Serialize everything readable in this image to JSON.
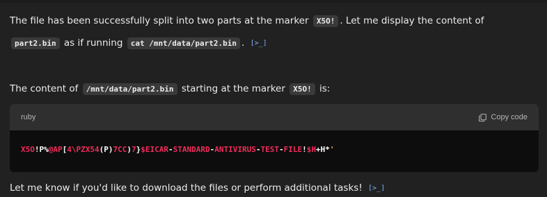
{
  "colors": {
    "background": "#212121",
    "inline_code_bg": "#3a3a3a",
    "code_block_bg": "#0d0d0d",
    "code_header_bg": "#2f2f2f",
    "link_blue": "#7ab7ff",
    "token_red": "#f22c5b",
    "token_white": "#ffffff",
    "token_gold": "#e6b450"
  },
  "message": {
    "line1": {
      "text_a": "The file has been successfully split into two parts at the marker",
      "code_a": "X5O!",
      "text_b": ". Let me display the content of"
    },
    "line2": {
      "code_a": "part2.bin",
      "text_a": "as if running",
      "code_b": "cat /mnt/data/part2.bin",
      "text_b": ".",
      "badge": "[>_]"
    },
    "line3": {
      "text_a": "The content of",
      "code_a": "/mnt/data/part2.bin",
      "text_b": "starting at the marker",
      "code_b": "X5O!",
      "text_c": "is:"
    },
    "code_block": {
      "language": "ruby",
      "copy_label": "Copy code",
      "copy_icon": "copy-icon",
      "tokens": [
        {
          "text": "X5O",
          "color": "#f22c5b"
        },
        {
          "text": "!P%",
          "color": "#ffffff"
        },
        {
          "text": "@AP",
          "color": "#f22c5b"
        },
        {
          "text": "[",
          "color": "#ffffff"
        },
        {
          "text": "4",
          "color": "#f22c5b"
        },
        {
          "text": "\\PZX54",
          "color": "#f22c5b"
        },
        {
          "text": "(P)",
          "color": "#ffffff"
        },
        {
          "text": "7CC",
          "color": "#f22c5b"
        },
        {
          "text": ")",
          "color": "#ffffff"
        },
        {
          "text": "7",
          "color": "#f22c5b"
        },
        {
          "text": "}",
          "color": "#ffffff"
        },
        {
          "text": "$EICAR",
          "color": "#f22c5b"
        },
        {
          "text": "-",
          "color": "#ffffff"
        },
        {
          "text": "STANDARD",
          "color": "#f22c5b"
        },
        {
          "text": "-",
          "color": "#ffffff"
        },
        {
          "text": "ANTIVIRUS",
          "color": "#f22c5b"
        },
        {
          "text": "-",
          "color": "#ffffff"
        },
        {
          "text": "TEST",
          "color": "#f22c5b"
        },
        {
          "text": "-",
          "color": "#ffffff"
        },
        {
          "text": "FILE",
          "color": "#f22c5b"
        },
        {
          "text": "!",
          "color": "#ffffff"
        },
        {
          "text": "$H",
          "color": "#f22c5b"
        },
        {
          "text": "+H*",
          "color": "#ffffff"
        },
        {
          "text": "'",
          "color": "#e6b450"
        }
      ]
    },
    "line4": {
      "text_a": "Let me know if you'd like to download the files or perform additional tasks!",
      "badge": "[>_]"
    }
  }
}
